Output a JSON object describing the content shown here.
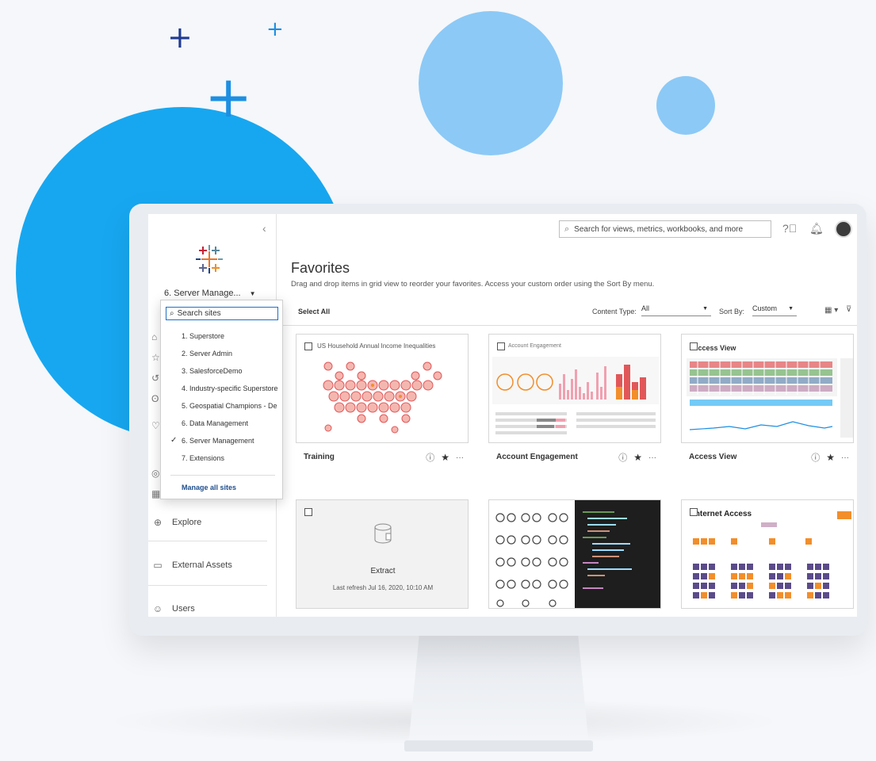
{
  "colors": {
    "accent_blue": "#17a7f0",
    "light_blue": "#8cc9f6",
    "plus_dark": "#1f3a93",
    "plus_light": "#1c8fe3",
    "link": "#1f4e8c",
    "heart_red": "#e15759"
  },
  "sidebar": {
    "site_name": "6. Server Manage...",
    "items": [
      {
        "icon": "explore-icon",
        "label": "Explore"
      },
      {
        "icon": "external-assets-icon",
        "label": "External Assets"
      },
      {
        "icon": "users-icon",
        "label": "Users"
      }
    ]
  },
  "site_dropdown": {
    "search_placeholder": "Search sites",
    "sites": [
      "1. Superstore",
      "2. Server Admin",
      "3. SalesforceDemo",
      "4. Industry-specific Superstore",
      "5. Geospatial Champions - De",
      "6. Data Management",
      "6. Server Management",
      "7. Extensions"
    ],
    "selected_index": 6,
    "manage_label": "Manage all sites"
  },
  "header": {
    "search_placeholder": "Search for views, metrics, workbooks, and more"
  },
  "main": {
    "title": "Favorites",
    "subtitle": "Drag and drop items in grid view to reorder your favorites. Access your custom order using the Sort By menu.",
    "select_all": "Select All",
    "content_type_label": "Content Type:",
    "content_type_value": "All",
    "sort_by_label": "Sort By:",
    "sort_by_value": "Custom"
  },
  "cards": [
    {
      "name": "Training",
      "thumb_title": "US Household Annual Income Inequalities"
    },
    {
      "name": "Account Engagement",
      "thumb_title": "Account Engagement"
    },
    {
      "name": "Access View",
      "thumb_title": "Access View"
    },
    {
      "name": "",
      "type_label": "Extract",
      "refresh": "Last refresh Jul 16, 2020, 10:10 AM"
    },
    {
      "name": ""
    },
    {
      "name": "",
      "thumb_title": "Internet Access"
    }
  ]
}
